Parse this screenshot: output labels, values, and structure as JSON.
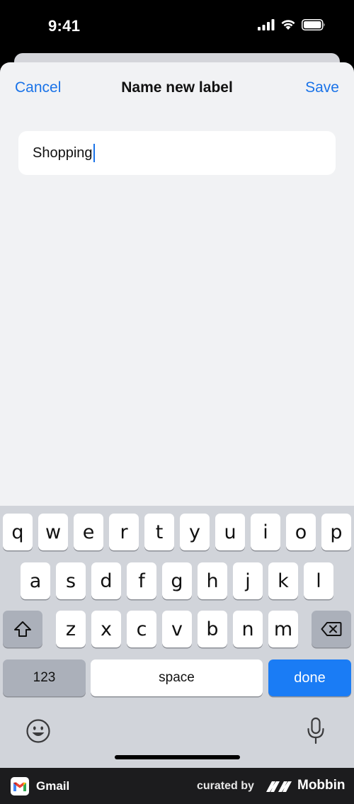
{
  "status_bar": {
    "time": "9:41"
  },
  "nav": {
    "cancel_label": "Cancel",
    "title": "Name new label",
    "save_label": "Save"
  },
  "input": {
    "value": "Shopping"
  },
  "keyboard": {
    "row1": [
      "q",
      "w",
      "e",
      "r",
      "t",
      "y",
      "u",
      "i",
      "o",
      "p"
    ],
    "row2": [
      "a",
      "s",
      "d",
      "f",
      "g",
      "h",
      "j",
      "k",
      "l"
    ],
    "row3": [
      "z",
      "x",
      "c",
      "v",
      "b",
      "n",
      "m"
    ],
    "numbers_label": "123",
    "space_label": "space",
    "done_label": "done"
  },
  "footer": {
    "app_name": "Gmail",
    "curated_label": "curated by",
    "brand": "Mobbin"
  },
  "colors": {
    "accent": "#1a73e8",
    "done_key": "#1a7cf5",
    "keyboard_bg": "#d1d4da",
    "sheet_bg": "#f1f2f4"
  }
}
